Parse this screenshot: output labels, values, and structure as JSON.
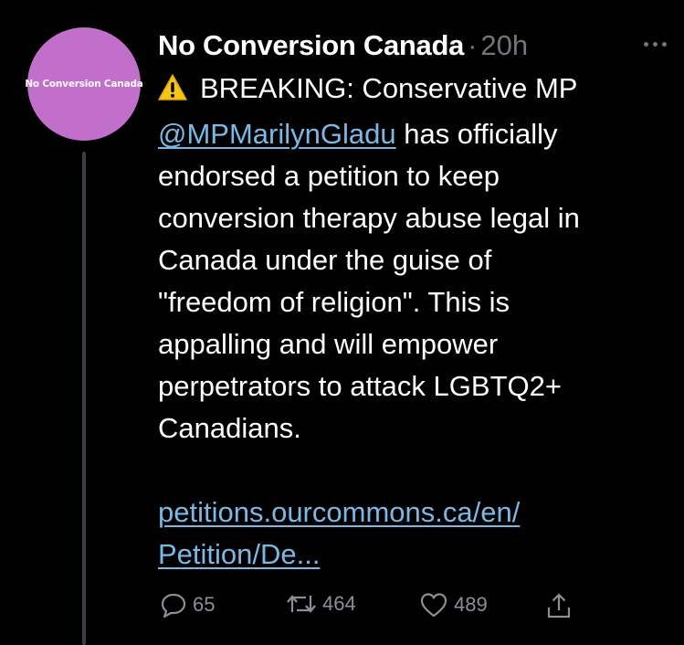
{
  "avatar": {
    "label": "No Conversion Canada",
    "color": "#c26fcc"
  },
  "tweet": {
    "display_name": "No Conversion Canada",
    "separator": "·",
    "time": "20h",
    "lines": {
      "l1": "BREAKING: Conservative MP",
      "mention": "@MPMarilynGladu",
      "l2_rest": " has officially",
      "l3": "endorsed a petition to keep",
      "l4": "conversion therapy abuse legal in",
      "l5": "Canada under the guise of",
      "l6": "\"freedom of religion\". This is",
      "l7": "appalling and will empower",
      "l8": "perpetrators to attack LGBTQ2+",
      "l9": "Canadians.",
      "link1": "petitions.ourcommons.ca/en/",
      "link2": "Petition/De..."
    },
    "warning_icon": "warning-sign-icon"
  },
  "actions": {
    "replies": "65",
    "retweets": "464",
    "likes": "489"
  },
  "colors": {
    "link": "#7ab8e6",
    "muted": "#71767b",
    "background": "#000000"
  }
}
